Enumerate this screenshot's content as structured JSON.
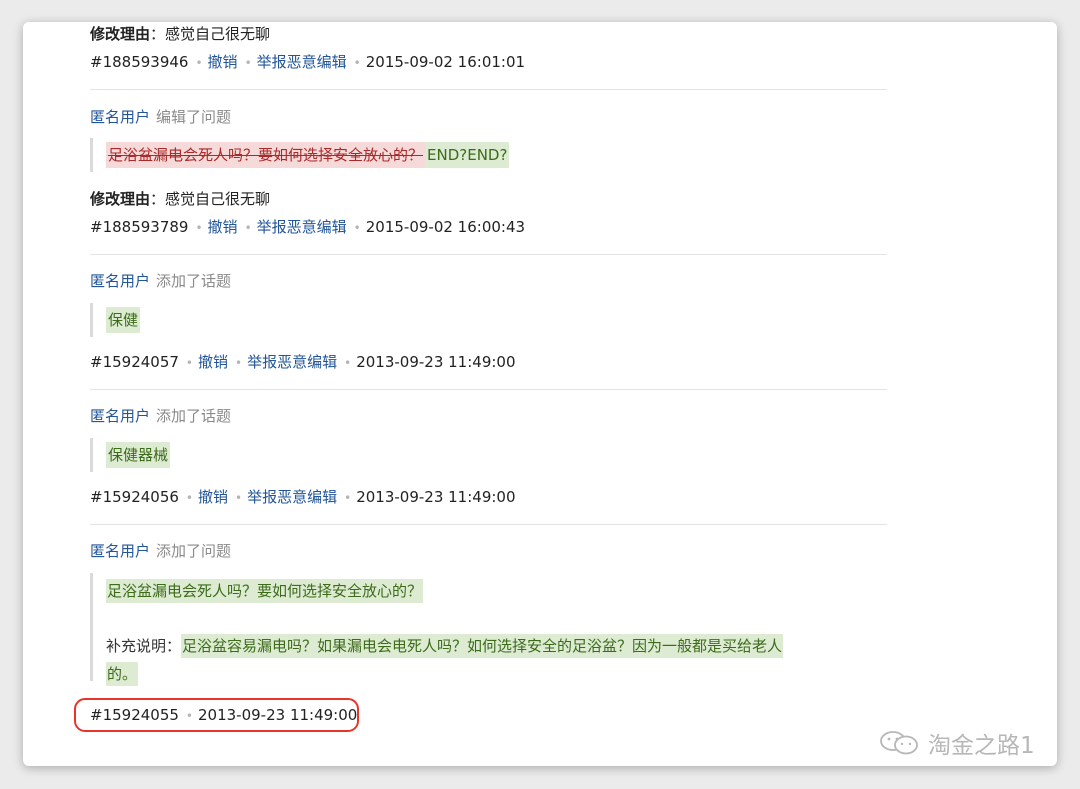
{
  "entries": [
    {
      "reason_label": "修改理由",
      "reason_sep": "：",
      "reason_text": "感觉自己很无聊",
      "id": "#188593946",
      "undo_label": "撤销",
      "report_label": "举报恶意编辑",
      "timestamp": "2015-09-02 16:01:01"
    },
    {
      "user": "匿名用户",
      "action": "编辑了问题",
      "deleted_text": "足浴盆漏电会死人吗？要如何选择安全放心的？",
      "inserted_text": "END?END?",
      "reason_label": "修改理由",
      "reason_sep": "：",
      "reason_text": "感觉自己很无聊",
      "id": "#188593789",
      "undo_label": "撤销",
      "report_label": "举报恶意编辑",
      "timestamp": "2015-09-02 16:00:43"
    },
    {
      "user": "匿名用户",
      "action": "添加了话题",
      "topic": "保健",
      "id": "#15924057",
      "undo_label": "撤销",
      "report_label": "举报恶意编辑",
      "timestamp": "2013-09-23 11:49:00"
    },
    {
      "user": "匿名用户",
      "action": "添加了话题",
      "topic": "保健器械",
      "id": "#15924056",
      "undo_label": "撤销",
      "report_label": "举报恶意编辑",
      "timestamp": "2013-09-23 11:49:00"
    },
    {
      "user": "匿名用户",
      "action": "添加了问题",
      "question": "足浴盆漏电会死人吗？要如何选择安全放心的？",
      "supplement_label": "补充说明：",
      "supplement_line1": "足浴盆容易漏电吗？如果漏电会电死人吗？如何选择安全的足浴盆？因为一般都是买给老人",
      "supplement_line2": "的。",
      "id": "#15924055",
      "timestamp": "2013-09-23 11:49:00"
    }
  ],
  "watermark": "淘金之路1",
  "colors": {
    "link": "#225599",
    "insert_bg": "#ddebd3",
    "delete_bg": "#f6dada",
    "highlight": "#e8352a"
  }
}
